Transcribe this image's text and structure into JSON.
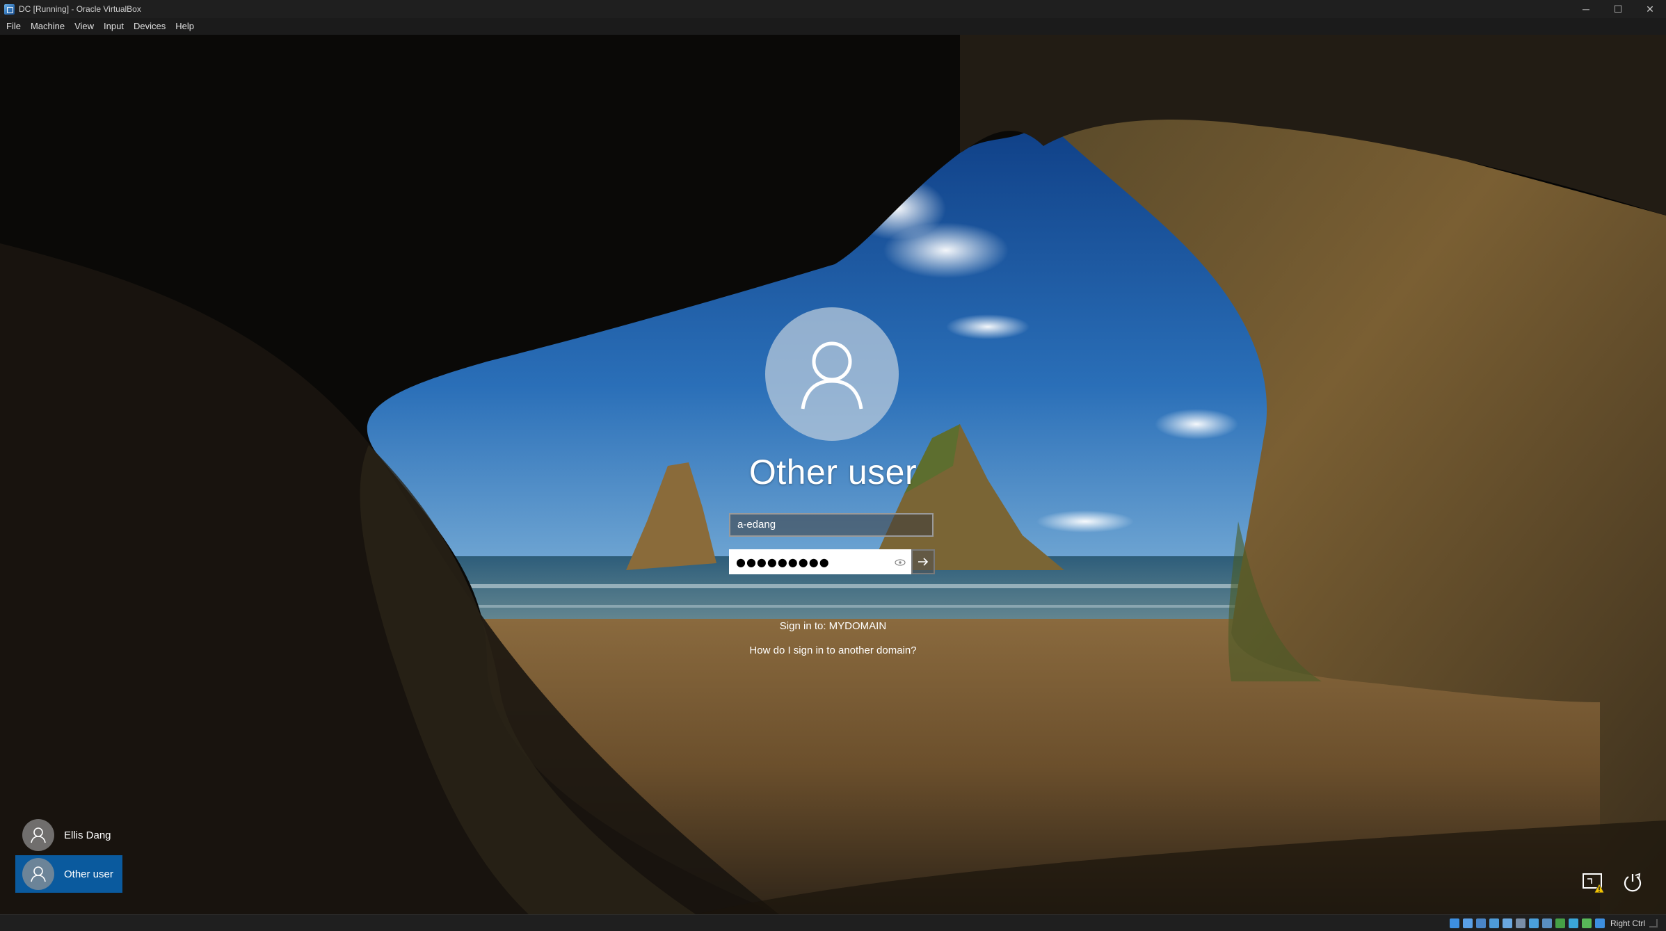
{
  "window": {
    "title": "DC [Running] - Oracle VirtualBox",
    "controls": {
      "minimize": "─",
      "maximize": "☐",
      "close": "✕"
    }
  },
  "menubar": {
    "items": [
      "File",
      "Machine",
      "View",
      "Input",
      "Devices",
      "Help"
    ]
  },
  "login": {
    "user_title": "Other user",
    "username_value": "a-edang",
    "password_masked": "●●●●●●●●●",
    "sign_in_to": "Sign in to: MYDOMAIN",
    "help_link": "How do I sign in to another domain?"
  },
  "user_list": [
    {
      "name": "Ellis Dang",
      "selected": false
    },
    {
      "name": "Other user",
      "selected": true
    }
  ],
  "corner_icons": [
    "network-warning-icon",
    "ease-of-access-power-icon"
  ],
  "statusbar": {
    "host_key": "Right Ctrl",
    "icons": [
      {
        "name": "hard-disk-icon",
        "color": "#3d8fe0"
      },
      {
        "name": "optical-drive-icon",
        "color": "#5aa0e6"
      },
      {
        "name": "audio-icon",
        "color": "#4a86c8"
      },
      {
        "name": "network-icon",
        "color": "#4e9bd8"
      },
      {
        "name": "usb-icon",
        "color": "#6aa8e0"
      },
      {
        "name": "shared-folders-icon",
        "color": "#7a8fa8"
      },
      {
        "name": "display-icon",
        "color": "#4aa0dc"
      },
      {
        "name": "recording-icon",
        "color": "#5a8fc0"
      },
      {
        "name": "cpu-icon",
        "color": "#46a046"
      },
      {
        "name": "guest-additions-icon",
        "color": "#3aa6d8"
      },
      {
        "name": "mouse-integration-icon",
        "color": "#58b858"
      },
      {
        "name": "keyboard-capture-icon",
        "color": "#3d8fe0"
      }
    ]
  }
}
